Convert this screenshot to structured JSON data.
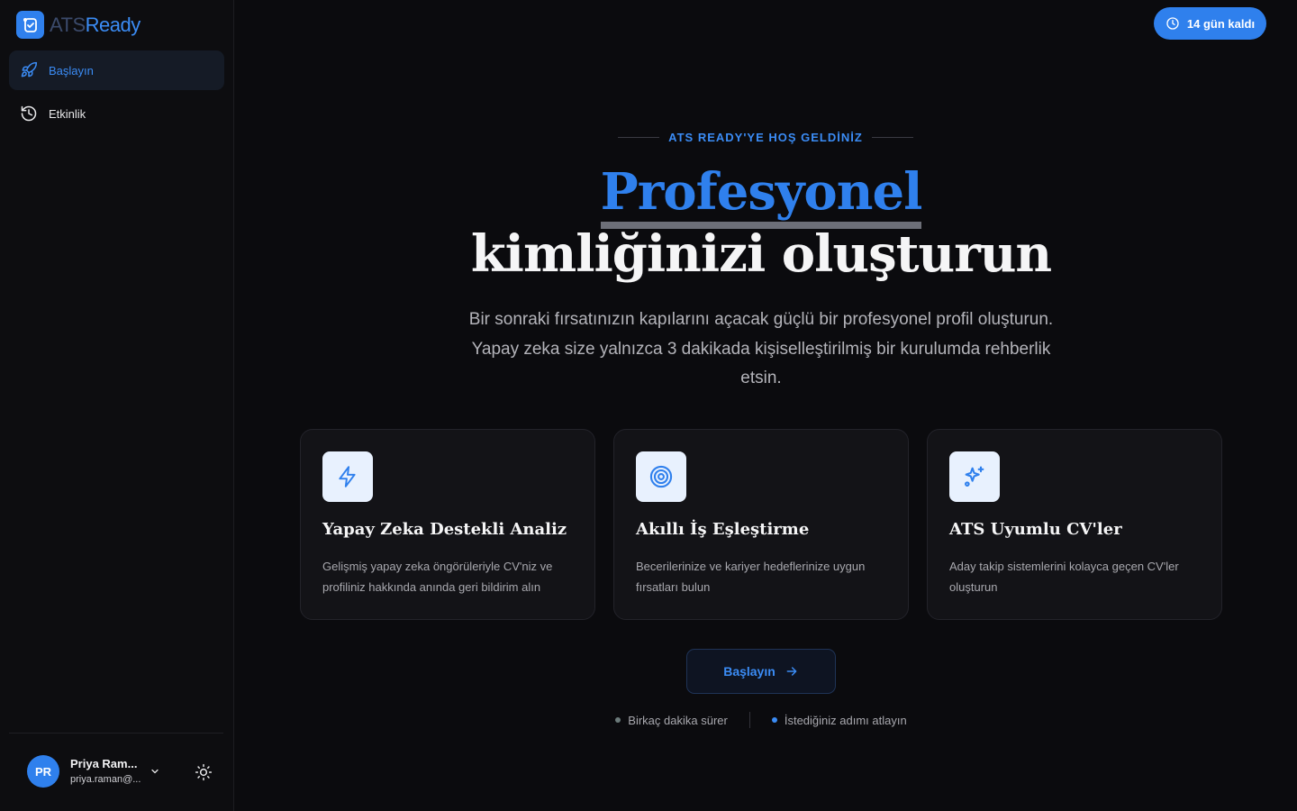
{
  "brand": {
    "name_part1": "ATS",
    "name_part2": "Ready",
    "accent": "#2f80ed"
  },
  "sidebar": {
    "items": [
      {
        "label": "Başlayın",
        "icon": "rocket-icon",
        "active": true
      },
      {
        "label": "Etkinlik",
        "icon": "history-icon",
        "active": false
      }
    ],
    "user": {
      "initials": "PR",
      "name": "Priya Ram...",
      "email": "priya.raman@..."
    }
  },
  "header": {
    "trial_label": "14 gün kaldı"
  },
  "hero": {
    "eyebrow": "ATS READY'YE HOŞ GELDİNİZ",
    "title_highlight": "Profesyonel",
    "title_rest": "kimliğinizi oluşturun",
    "lead": "Bir sonraki fırsatınızın kapılarını açacak güçlü bir profesyonel profil oluşturun. Yapay zeka size yalnızca 3 dakikada kişiselleştirilmiş bir kurulumda rehberlik etsin."
  },
  "cards": [
    {
      "title": "Yapay Zeka Destekli Analiz",
      "desc": "Gelişmiş yapay zeka öngörüleriyle CV'niz ve profiliniz hakkında anında geri bildirim alın",
      "icon": "lightning-icon"
    },
    {
      "title": "Akıllı İş Eşleştirme",
      "desc": "Becerilerinize ve kariyer hedeflerinize uygun fırsatları bulun",
      "icon": "target-icon"
    },
    {
      "title": "ATS Uyumlu CV'ler",
      "desc": "Aday takip sistemlerini kolayca geçen CV'ler oluşturun",
      "icon": "sparkles-icon"
    }
  ],
  "cta": {
    "label": "Başlayın"
  },
  "notes": [
    {
      "label": "Birkaç dakika sürer",
      "dot_color": "#6b7a7a"
    },
    {
      "label": "İstediğiniz adımı atlayın",
      "dot_color": "#3b8cf5"
    }
  ]
}
